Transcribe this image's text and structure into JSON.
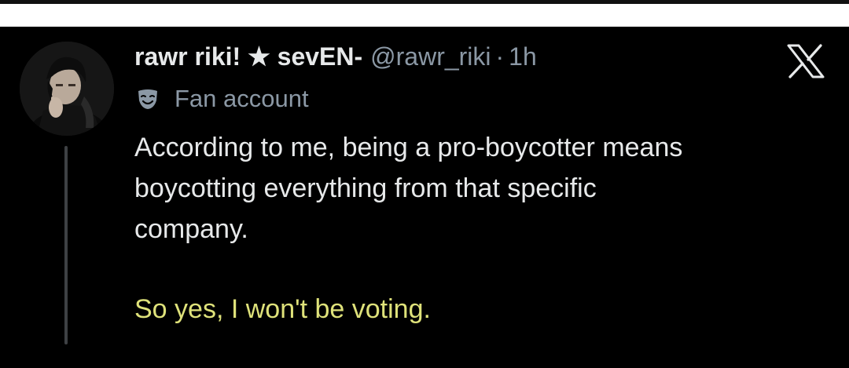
{
  "tweet": {
    "display_name": "rawr riki! ★ sevEN-",
    "handle": "@rawr_riki",
    "separator": "·",
    "time": "1h",
    "label": "Fan account",
    "body_lines": [
      "According to me, being a pro-boycotter means",
      "boycotting everything from that specific",
      "company."
    ],
    "highlight_line": "So yes, I won't be voting."
  },
  "icons": {
    "label_icon": "mask-icon",
    "brand_icon": "x-logo-icon",
    "avatar": "profile-photo"
  },
  "colors": {
    "background": "#000000",
    "text_primary": "#e7e9ea",
    "text_secondary": "#8b98a5",
    "highlight_text": "#dfe27a",
    "thread_line": "#3e4144"
  }
}
